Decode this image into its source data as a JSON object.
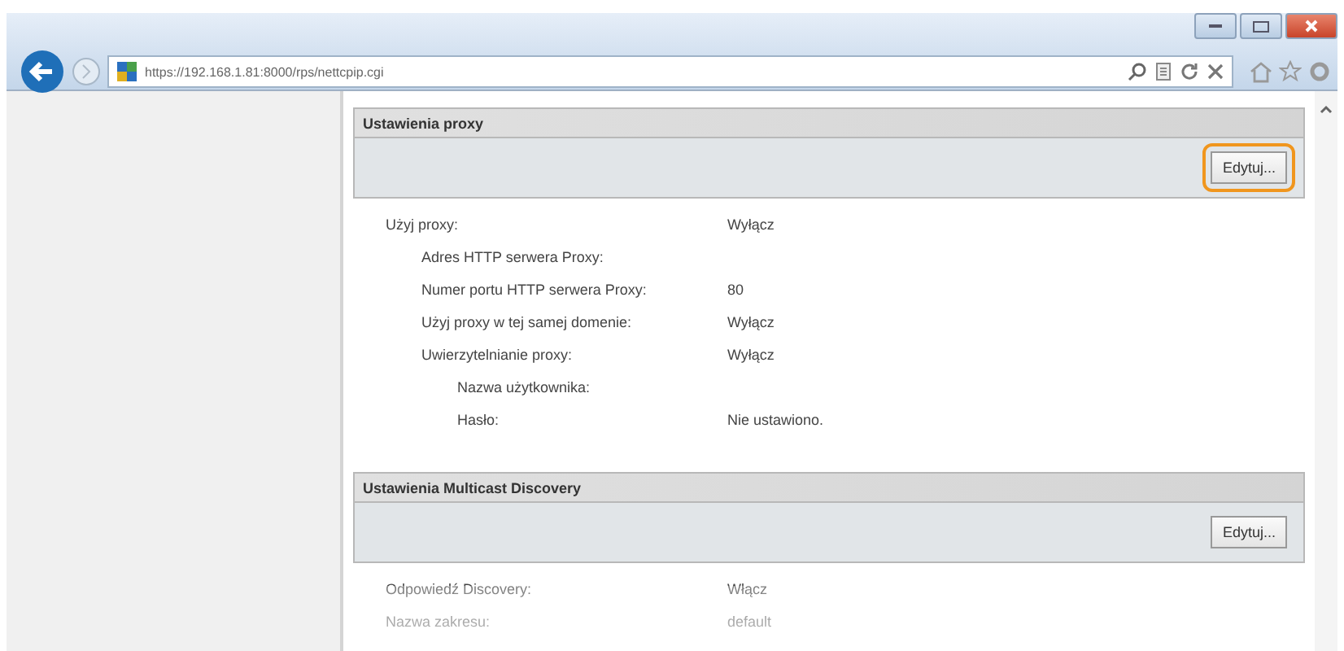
{
  "browser": {
    "url": "https://192.168.1.81:8000/rps/nettcpip.cgi"
  },
  "sections": [
    {
      "title": "Ustawienia proxy",
      "button": {
        "label": "Edytuj...",
        "highlighted": true
      },
      "rows": [
        {
          "label": "Użyj proxy:",
          "value": "Wyłącz",
          "children": [
            {
              "label": "Adres HTTP serwera Proxy:"
            },
            {
              "label": "Numer portu HTTP serwera Proxy:",
              "value": "80"
            },
            {
              "label": "Użyj proxy w tej samej domenie:",
              "value": "Wyłącz"
            },
            {
              "label": "Uwierzytelnianie proxy:",
              "value": "Wyłącz",
              "children": [
                {
                  "label": "Nazwa użytkownika:"
                },
                {
                  "label": "Hasło:",
                  "value": "Nie ustawiono."
                }
              ]
            }
          ]
        }
      ]
    },
    {
      "title": "Ustawienia Multicast Discovery",
      "button": {
        "label": "Edytuj...",
        "highlighted": false
      },
      "rows": [
        {
          "label": "Odpowiedź Discovery:",
          "value": "Włącz"
        },
        {
          "label": "Nazwa zakresu:",
          "value": "default"
        }
      ]
    }
  ]
}
